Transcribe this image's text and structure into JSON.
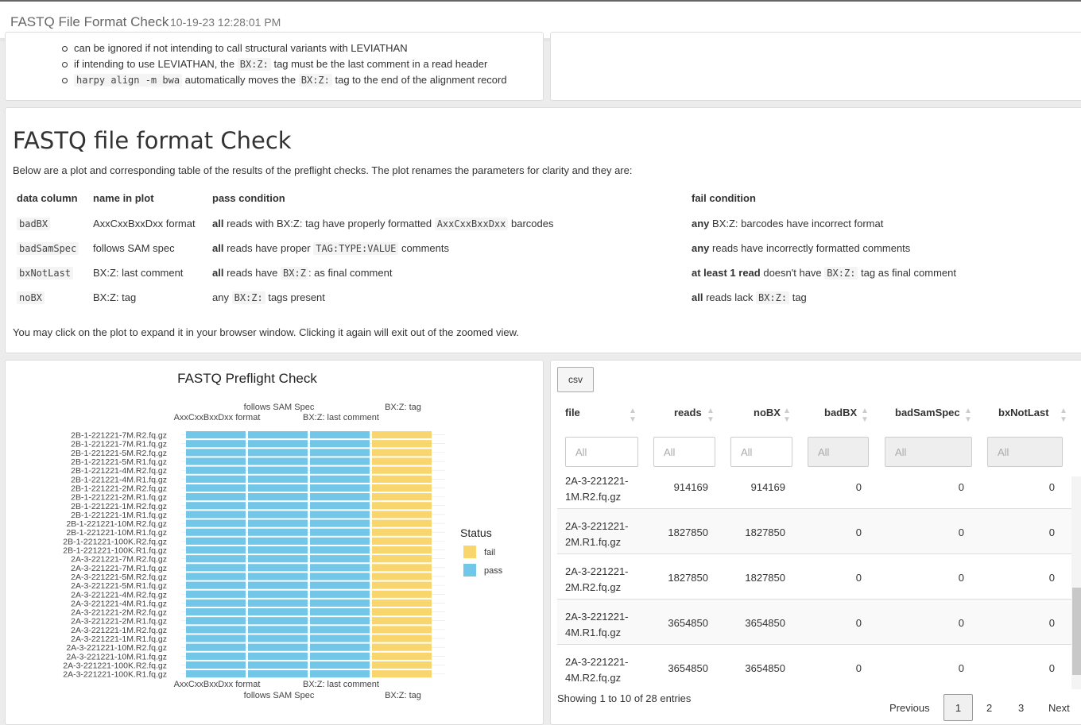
{
  "header": {
    "title": "FASTQ File Format Check",
    "timestamp": "10-19-23 12:28:01 PM"
  },
  "notes": {
    "b1": "can be ignored if not intending to call structural variants with LEVIATHAN",
    "b2_pre": "if intending to use LEVIATHAN, the",
    "b2_code": "BX:Z:",
    "b2_post": "tag must be the last comment in a read header",
    "b3_code": "harpy align -m bwa",
    "b3_mid": "automatically moves the",
    "b3_code2": "BX:Z:",
    "b3_post": "tag to the end of the alignment record"
  },
  "section": {
    "title": "FASTQ file format Check",
    "intro": "Below are a plot and corresponding table of the results of the preflight checks. The plot renames the parameters for clarity and they are:",
    "headers": [
      "data column",
      "name in plot",
      "pass condition",
      "fail condition"
    ],
    "rows": [
      {
        "col": "badBX",
        "name": "AxxCxxBxxDxx format",
        "pass_b": "all",
        "pass_t": "reads with BX:Z: tag have properly formatted",
        "pass_c": "AxxCxxBxxDxx",
        "pass_t2": "barcodes",
        "fail_b": "any",
        "fail_t": "BX:Z: barcodes have incorrect format",
        "fail_c": "",
        "fail_t2": ""
      },
      {
        "col": "badSamSpec",
        "name": "follows SAM spec",
        "pass_b": "all",
        "pass_t": "reads have proper",
        "pass_c": "TAG:TYPE:VALUE",
        "pass_t2": "comments",
        "fail_b": "any",
        "fail_t": "reads have incorrectly formatted comments",
        "fail_c": "",
        "fail_t2": ""
      },
      {
        "col": "bxNotLast",
        "name": "BX:Z: last comment",
        "pass_b": "all",
        "pass_t": "reads have",
        "pass_c": "BX:Z",
        "pass_t2": ": as final comment",
        "fail_b": "at least 1 read",
        "fail_t": "doesn't have",
        "fail_c": "BX:Z:",
        "fail_t2": "tag as final comment"
      },
      {
        "col": "noBX",
        "name": "BX:Z: tag",
        "pass_b": "",
        "pass_t": "any",
        "pass_c": "BX:Z:",
        "pass_t2": "tags present",
        "fail_b": "all",
        "fail_t": "reads lack",
        "fail_c": "BX:Z:",
        "fail_t2": "tag"
      }
    ],
    "zoom_note": "You may click on the plot to expand it in your browser window. Clicking it again will exit out of the zoomed view."
  },
  "chart_data": {
    "type": "heatmap",
    "title": "FASTQ Preflight Check",
    "columns": [
      "AxxCxxBxxDxx format",
      "follows SAM Spec",
      "BX:Z: last comment",
      "BX:Z: tag"
    ],
    "rows": [
      "2B-1-221221-7M.R2.fq.gz",
      "2B-1-221221-7M.R1.fq.gz",
      "2B-1-221221-5M.R2.fq.gz",
      "2B-1-221221-5M.R1.fq.gz",
      "2B-1-221221-4M.R2.fq.gz",
      "2B-1-221221-4M.R1.fq.gz",
      "2B-1-221221-2M.R2.fq.gz",
      "2B-1-221221-2M.R1.fq.gz",
      "2B-1-221221-1M.R2.fq.gz",
      "2B-1-221221-1M.R1.fq.gz",
      "2B-1-221221-10M.R2.fq.gz",
      "2B-1-221221-10M.R1.fq.gz",
      "2B-1-221221-100K.R2.fq.gz",
      "2B-1-221221-100K.R1.fq.gz",
      "2A-3-221221-7M.R2.fq.gz",
      "2A-3-221221-7M.R1.fq.gz",
      "2A-3-221221-5M.R2.fq.gz",
      "2A-3-221221-5M.R1.fq.gz",
      "2A-3-221221-4M.R2.fq.gz",
      "2A-3-221221-4M.R1.fq.gz",
      "2A-3-221221-2M.R2.fq.gz",
      "2A-3-221221-2M.R1.fq.gz",
      "2A-3-221221-1M.R2.fq.gz",
      "2A-3-221221-1M.R1.fq.gz",
      "2A-3-221221-10M.R2.fq.gz",
      "2A-3-221221-10M.R1.fq.gz",
      "2A-3-221221-100K.R2.fq.gz",
      "2A-3-221221-100K.R1.fq.gz"
    ],
    "status_by_column": [
      "pass",
      "pass",
      "pass",
      "fail"
    ],
    "legend_title": "Status",
    "legend": [
      {
        "label": "fail",
        "color": "#F8D66D"
      },
      {
        "label": "pass",
        "color": "#72C6E8"
      }
    ],
    "legend_position": "right"
  },
  "table": {
    "csv_label": "csv",
    "columns": [
      "file",
      "reads",
      "noBX",
      "badBX",
      "badSamSpec",
      "bxNotLast"
    ],
    "filter_placeholder": "All",
    "rows": [
      {
        "file": "2A-3-221221-1M.R2.fq.gz",
        "reads": "914169",
        "noBX": "914169",
        "badBX": "0",
        "badSamSpec": "0",
        "bxNotLast": "0"
      },
      {
        "file": "2A-3-221221-2M.R1.fq.gz",
        "reads": "1827850",
        "noBX": "1827850",
        "badBX": "0",
        "badSamSpec": "0",
        "bxNotLast": "0"
      },
      {
        "file": "2A-3-221221-2M.R2.fq.gz",
        "reads": "1827850",
        "noBX": "1827850",
        "badBX": "0",
        "badSamSpec": "0",
        "bxNotLast": "0"
      },
      {
        "file": "2A-3-221221-4M.R1.fq.gz",
        "reads": "3654850",
        "noBX": "3654850",
        "badBX": "0",
        "badSamSpec": "0",
        "bxNotLast": "0"
      },
      {
        "file": "2A-3-221221-4M.R2.fq.gz",
        "reads": "3654850",
        "noBX": "3654850",
        "badBX": "0",
        "badSamSpec": "0",
        "bxNotLast": "0"
      }
    ],
    "info": "Showing 1 to 10 of 28 entries",
    "pagination": {
      "previous": "Previous",
      "pages": [
        "1",
        "2",
        "3"
      ],
      "next": "Next"
    }
  }
}
